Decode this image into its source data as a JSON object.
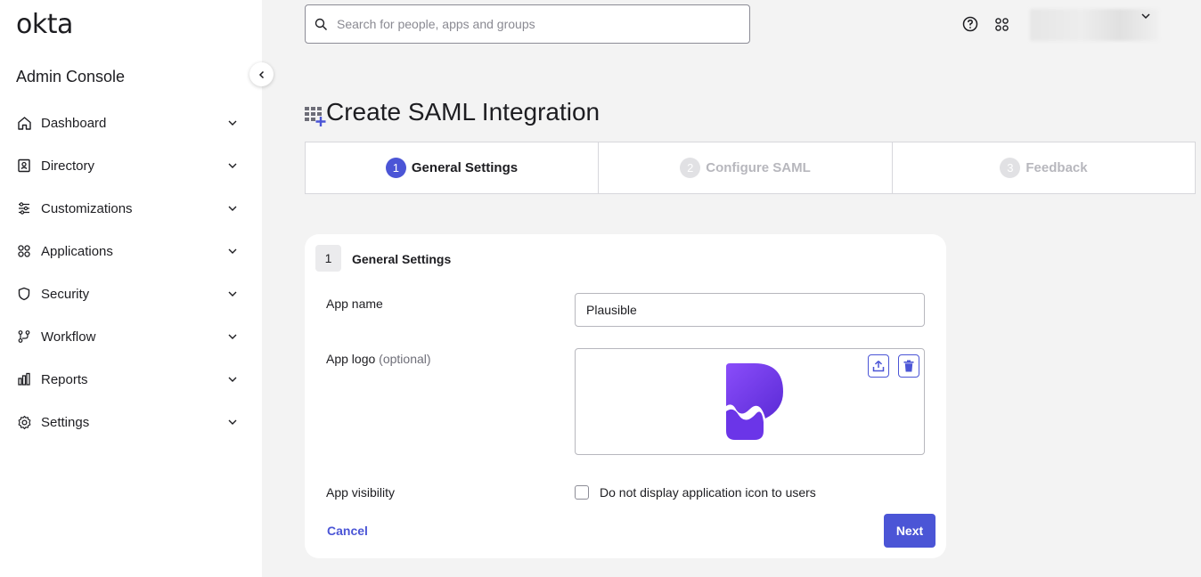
{
  "brand": {
    "logo_text": "okta",
    "console_title": "Admin Console"
  },
  "sidebar": {
    "items": [
      {
        "label": "Dashboard",
        "icon": "home-icon"
      },
      {
        "label": "Directory",
        "icon": "directory-icon"
      },
      {
        "label": "Customizations",
        "icon": "sliders-icon"
      },
      {
        "label": "Applications",
        "icon": "apps-grid-icon"
      },
      {
        "label": "Security",
        "icon": "shield-icon"
      },
      {
        "label": "Workflow",
        "icon": "workflow-icon"
      },
      {
        "label": "Reports",
        "icon": "bar-chart-icon"
      },
      {
        "label": "Settings",
        "icon": "gear-icon"
      }
    ]
  },
  "search": {
    "placeholder": "Search for people, apps and groups",
    "value": ""
  },
  "page": {
    "title": "Create SAML Integration"
  },
  "steps": [
    {
      "number": "1",
      "label": "General Settings",
      "state": "active"
    },
    {
      "number": "2",
      "label": "Configure SAML",
      "state": "inactive"
    },
    {
      "number": "3",
      "label": "Feedback",
      "state": "inactive"
    }
  ],
  "form": {
    "section_number": "1",
    "section_title": "General Settings",
    "app_name_label": "App name",
    "app_name_value": "Plausible",
    "app_logo_label": "App logo",
    "app_logo_optional": "(optional)",
    "app_visibility_label": "App visibility",
    "visibility_checkbox_label": "Do not display application icon to users",
    "visibility_checked": false,
    "cancel_label": "Cancel",
    "next_label": "Next"
  },
  "colors": {
    "accent": "#4b55d6",
    "logo_purple": "#6a3de8"
  }
}
